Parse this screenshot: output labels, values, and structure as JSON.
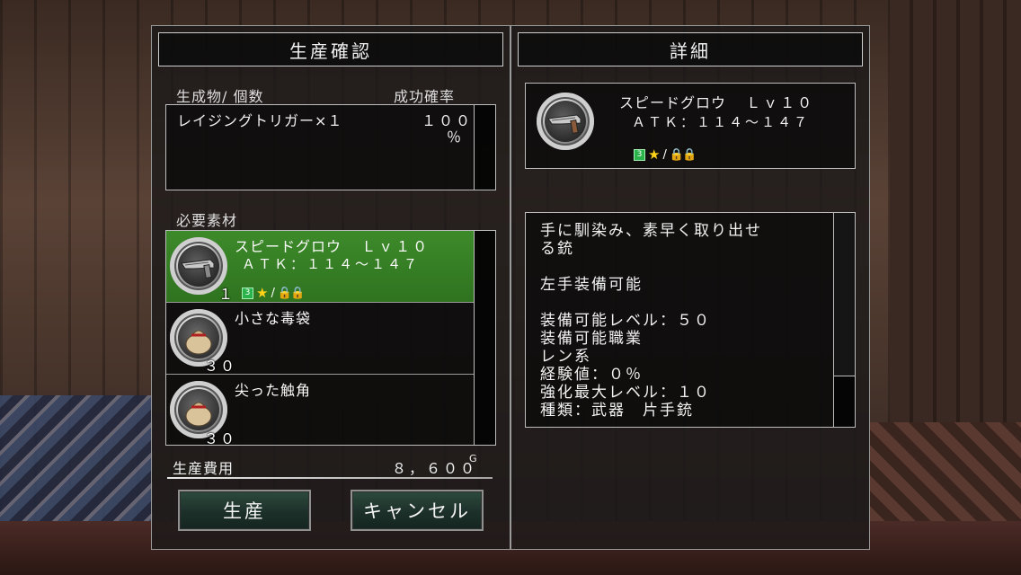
{
  "left_panel": {
    "title": "生産確認",
    "product_header": "生成物/ 個数",
    "rate_header": "成功確率",
    "product": {
      "name": "レイジングトリガー×１",
      "rate": "１００",
      "rate_unit": "％"
    },
    "materials_header": "必要素材",
    "materials": [
      {
        "name": "スピードグロウ",
        "level": "Ｌｖ１０",
        "atk": "ＡＴＫ：１１４～１４７",
        "count": "１",
        "icon": "gun-icon",
        "selected": true,
        "grade": "3"
      },
      {
        "name": "小さな毒袋",
        "count": "３０",
        "icon": "bag-icon",
        "selected": false
      },
      {
        "name": "尖った触角",
        "count": "３０",
        "icon": "bag-icon",
        "selected": false
      }
    ],
    "cost_label": "生産費用",
    "cost_value": "８，６００",
    "cost_unit": "G",
    "produce_button": "生産",
    "cancel_button": "キャンセル"
  },
  "right_panel": {
    "title": "詳細",
    "item": {
      "name": "スピードグロウ",
      "level": "Ｌｖ１０",
      "atk": "ＡＴＫ：１１４～１４７",
      "grade": "3",
      "icon": "gun-icon"
    },
    "description_lines": [
      "手に馴染み、素早く取り出せ",
      "る銃",
      "",
      "左手装備可能",
      "",
      "装備可能レベル：５０",
      "装備可能職業",
      "レン系",
      "経験値：０％",
      "強化最大レベル：１０",
      "種類：武器　片手銃"
    ]
  },
  "colors": {
    "selected_row": "#3d8a2a",
    "badge_green": "#29b34a",
    "star": "#ffd21a"
  }
}
